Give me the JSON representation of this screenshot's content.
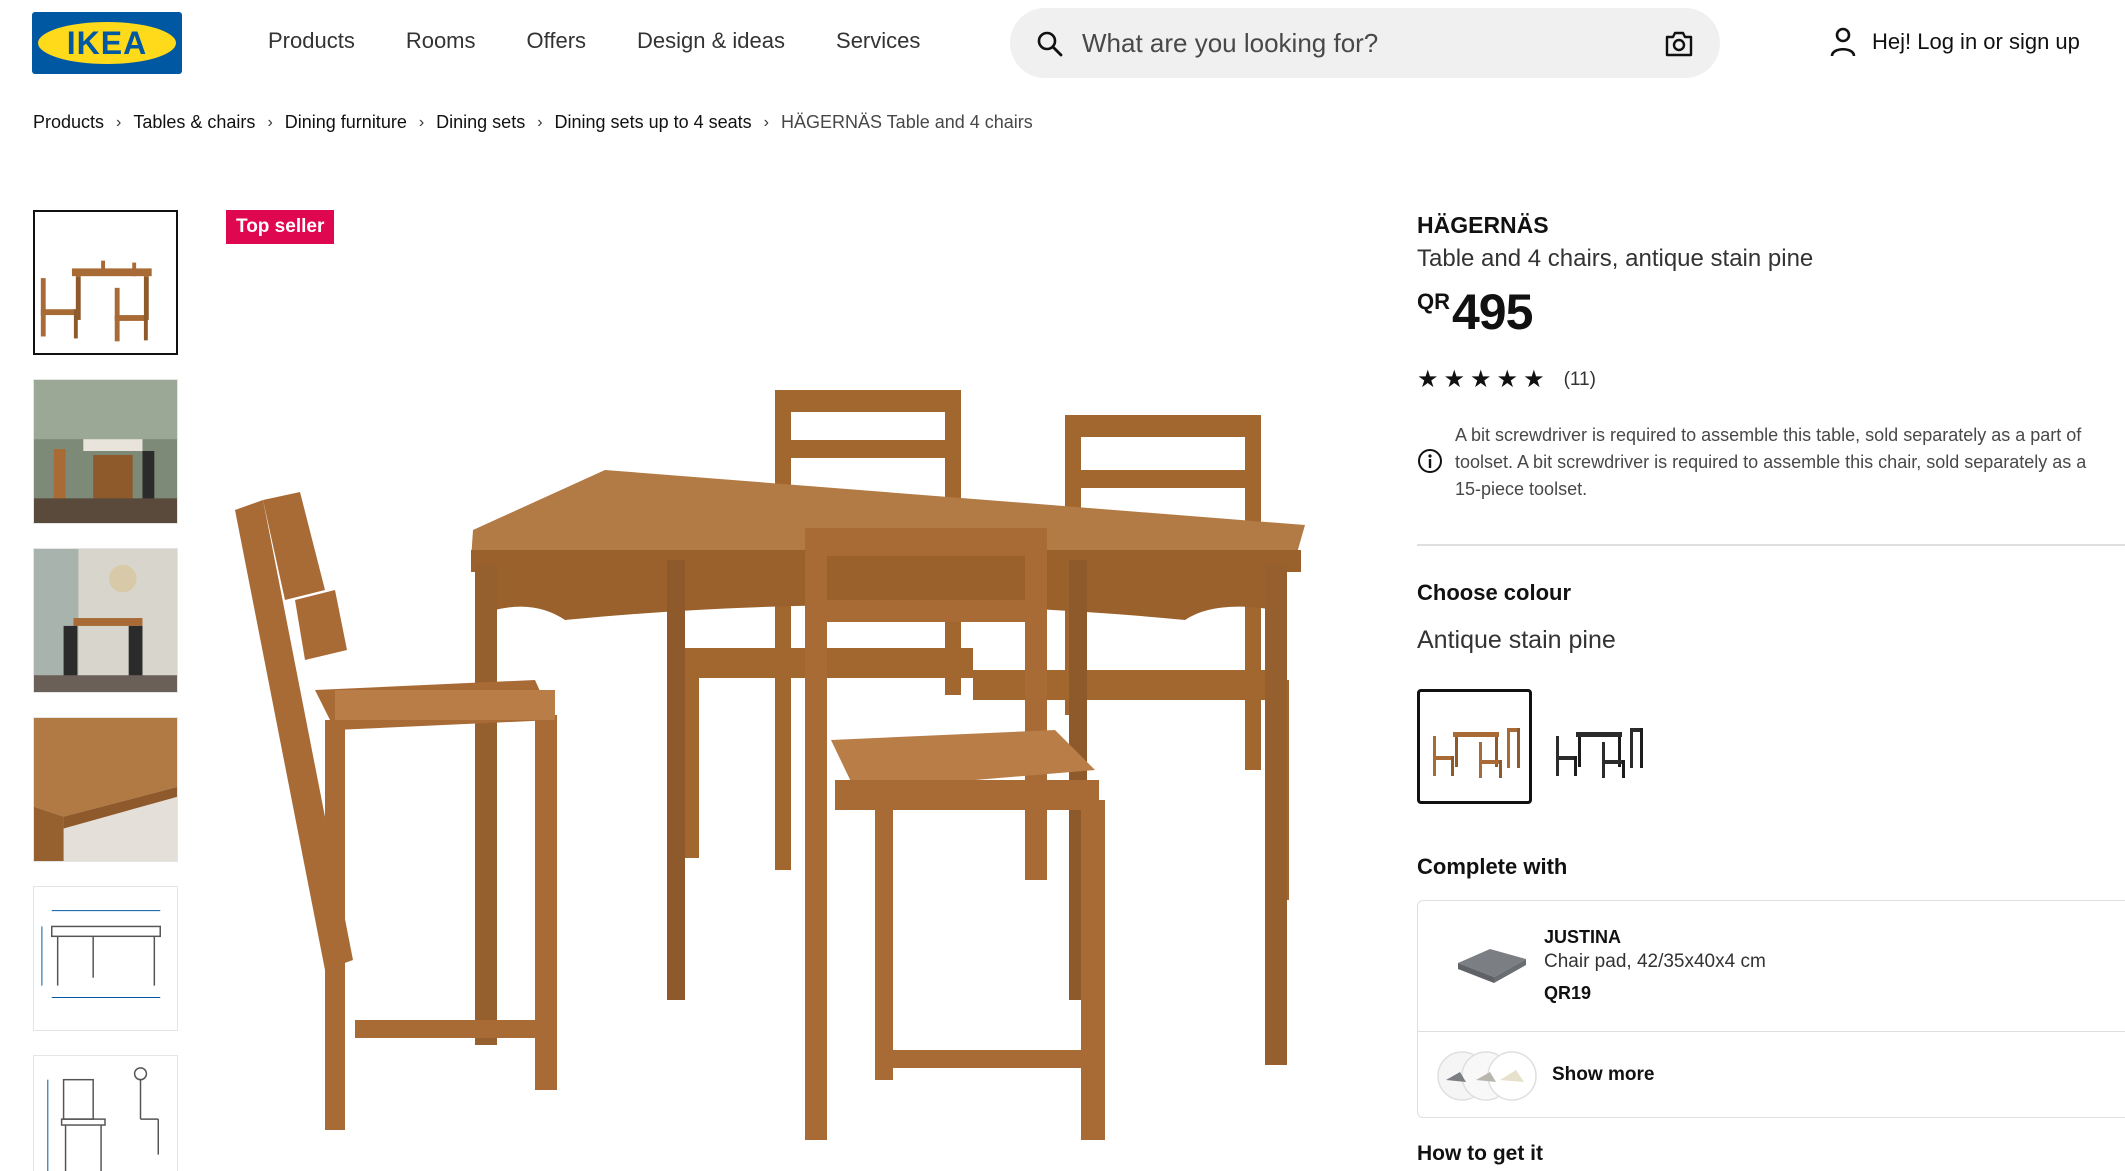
{
  "header": {
    "logo_text": "IKEA",
    "nav": [
      "Products",
      "Rooms",
      "Offers",
      "Design & ideas",
      "Services"
    ],
    "search_placeholder": "What are you looking for?",
    "login_text": "Hej! Log in or sign up"
  },
  "breadcrumb": [
    "Products",
    "Tables & chairs",
    "Dining furniture",
    "Dining sets",
    "Dining sets up to 4 seats",
    "HÄGERNÄS Table and 4 chairs"
  ],
  "badge": "Top seller",
  "product": {
    "name": "HÄGERNÄS",
    "description": "Table and 4 chairs, antique stain pine",
    "currency": "QR",
    "price": "495",
    "rating": 5,
    "review_count": "(11)",
    "notice_lines": [
      "A bit screwdriver is required to assemble this table, sold separately as a part of",
      "toolset. A bit screwdriver is required to assemble this chair, sold separately as a",
      "15-piece toolset."
    ],
    "choose_colour_label": "Choose colour",
    "colour_name": "Antique stain pine",
    "colours": [
      "antique stain pine",
      "black"
    ],
    "complete_with_label": "Complete with",
    "addon": {
      "name": "JUSTINA",
      "description": "Chair pad, 42/35x40x4 cm",
      "price": "QR19"
    },
    "show_more_label": "Show more",
    "how_to_label": "How to get it"
  },
  "colors": {
    "ikea_blue": "#0058a3",
    "ikea_yellow": "#ffda1a",
    "badge_red": "#e00751",
    "wood": "#a86b36"
  }
}
